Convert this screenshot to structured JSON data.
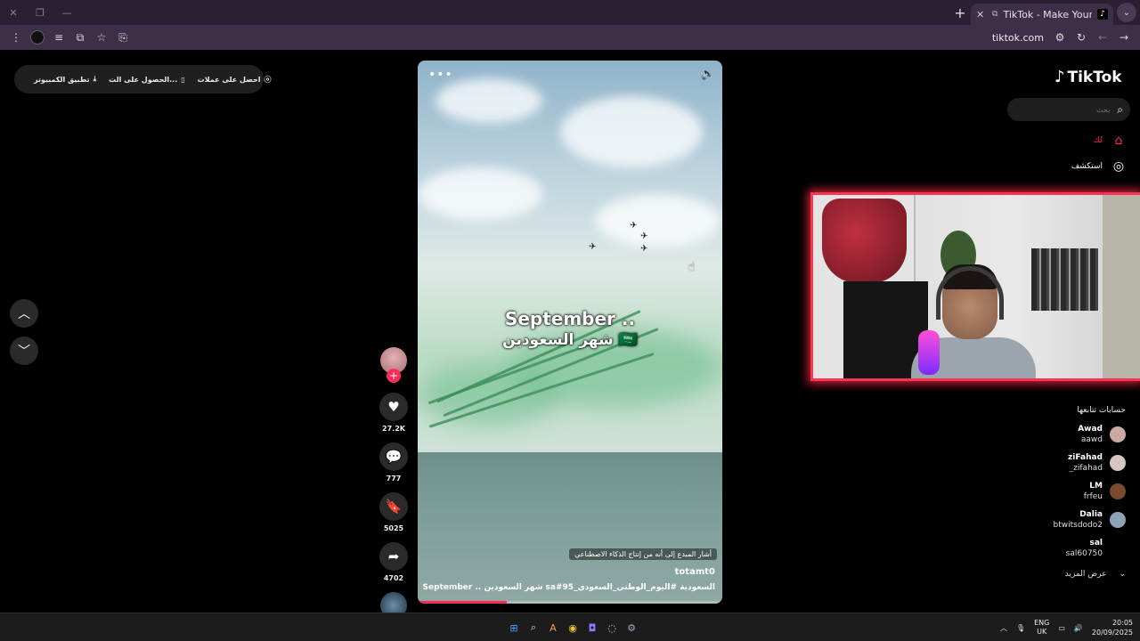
{
  "browser": {
    "tab_title": "TikTok - Make Your Day",
    "url": "tiktok.com"
  },
  "banner": {
    "item1": "احصل على عملات",
    "item2": "الحصول على الت...",
    "item3": "تطبيق الكمبيوتر"
  },
  "video": {
    "overlay_en": "September ..",
    "overlay_ar": "شهر السعودين 🇸🇦",
    "ai_notice": "أشار المبدع إلى أنه من إنتاج الذكاء الاصطناعي",
    "author": "totamt0",
    "description": "September .. شهر السعودين sa#السعودية #اليوم_الوطني_السعودي_95"
  },
  "actions": {
    "likes": "27.2K",
    "comments": "777",
    "saves": "5025",
    "shares": "4702"
  },
  "sidebar": {
    "logo": "TikTok",
    "search_placeholder": "بحث",
    "nav": [
      {
        "label": "لك"
      },
      {
        "label": "استكشف"
      }
    ],
    "following_title": "حسابات تتابعها",
    "accounts": [
      {
        "name": "Awad",
        "username": "aawd",
        "color": "#c9a9a0"
      },
      {
        "name": "ziFahad",
        "username": "_zifahad",
        "color": "#d9c4c4"
      },
      {
        "name": "LM",
        "username": "frfeu",
        "color": "#7a4a30"
      },
      {
        "name": "Dalia",
        "username": "btwitsdodo2",
        "color": "#8fa1b5"
      },
      {
        "name": "sal",
        "username": "sal60750",
        "color": "#000000"
      }
    ],
    "see_more": "عرض المزيد"
  },
  "taskbar": {
    "lang_top": "ENG",
    "lang_bottom": "UK",
    "time": "20:05",
    "date": "20/09/2025"
  },
  "colors": {
    "accent": "#fe2c55",
    "browser_frame": "#3d2f47"
  }
}
